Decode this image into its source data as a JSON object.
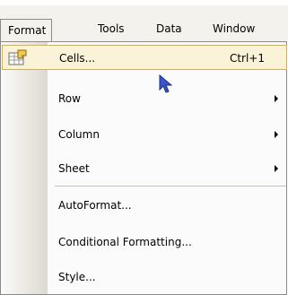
{
  "menubar": {
    "items": [
      {
        "label": "Format",
        "open": true
      },
      {
        "label": "Tools"
      },
      {
        "label": "Data"
      },
      {
        "label": "Window"
      }
    ]
  },
  "dropdown": {
    "items": [
      {
        "label": "Cells...",
        "shortcut": "Ctrl+1",
        "icon": "format-cells-icon",
        "highlighted": true
      },
      {
        "label": "Row",
        "submenu": true
      },
      {
        "label": "Column",
        "submenu": true
      },
      {
        "label": "Sheet",
        "submenu": true
      },
      {
        "label": "AutoFormat..."
      },
      {
        "label": "Conditional Formatting..."
      },
      {
        "label": "Style..."
      }
    ]
  },
  "colors": {
    "menubar_bg": "#f4f2ec",
    "highlight_bg": "#fbf3d8",
    "highlight_border": "#d7b04b",
    "cursor": "#3a55c8"
  }
}
